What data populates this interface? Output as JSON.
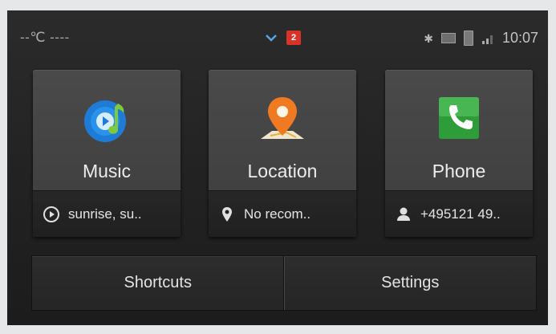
{
  "status_bar": {
    "temperature": "--℃ ----",
    "notification_count": "2",
    "time": "10:07",
    "icons": [
      "chevron-down-icon",
      "notification-badge-icon",
      "bluetooth-icon",
      "mail-icon",
      "battery-icon",
      "signal-icon"
    ]
  },
  "tiles": [
    {
      "label": "Music",
      "info": "sunrise, su..",
      "icon": "music-player-icon",
      "info_icon": "play-circle-icon"
    },
    {
      "label": "Location",
      "info": "No recom..",
      "icon": "map-pin-icon",
      "info_icon": "location-pin-icon"
    },
    {
      "label": "Phone",
      "info": "+495121 49..",
      "icon": "phone-icon",
      "info_icon": "contact-person-icon"
    }
  ],
  "buttons": {
    "shortcuts": "Shortcuts",
    "settings": "Settings"
  },
  "colors": {
    "badge": "#d8332a",
    "map_pin": "#f07a21",
    "phone_green": "#2f9c3a",
    "music_blue": "#1e7bd6"
  }
}
